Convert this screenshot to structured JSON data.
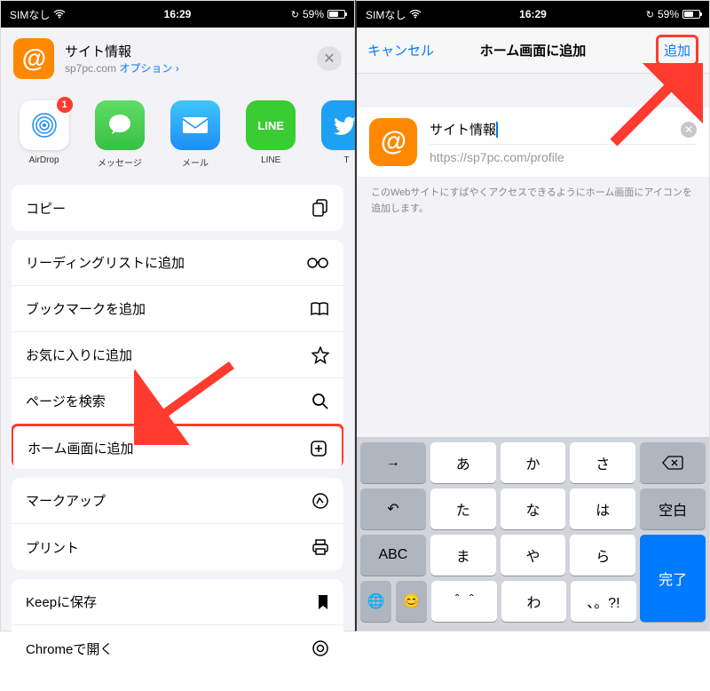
{
  "status": {
    "sim": "SIMなし",
    "wifi_icon": "wifi",
    "time": "16:29",
    "battery": "59%"
  },
  "left": {
    "header": {
      "title": "サイト情報",
      "domain": "sp7pc.com",
      "options": "オプション ›"
    },
    "apps": [
      {
        "name": "AirDrop",
        "badge": "1"
      },
      {
        "name": "メッセージ"
      },
      {
        "name": "メール"
      },
      {
        "name": "LINE"
      },
      {
        "name": "T"
      }
    ],
    "actions1": [
      "コピー"
    ],
    "actions2": [
      "リーディングリストに追加",
      "ブックマークを追加",
      "お気に入りに追加",
      "ページを検索",
      "ホーム画面に追加"
    ],
    "actions3": [
      "マークアップ",
      "プリント"
    ],
    "actions4": [
      "Keepに保存",
      "Chromeで開く"
    ]
  },
  "right": {
    "nav": {
      "cancel": "キャンセル",
      "title": "ホーム画面に追加",
      "add": "追加"
    },
    "form": {
      "title": "サイト情報",
      "url": "https://sp7pc.com/profile"
    },
    "help": "このWebサイトにすばやくアクセスできるようにホーム画面にアイコンを追加します。",
    "keys": {
      "r1": [
        "→",
        "あ",
        "か",
        "さ",
        "⌫"
      ],
      "r2": [
        "↶",
        "た",
        "な",
        "は",
        "空白"
      ],
      "r3": [
        "ABC",
        "ま",
        "や",
        "ら",
        "完了"
      ],
      "r4": [
        "🌐",
        "😊",
        "＾＾",
        "わ",
        "、。?!",
        ""
      ]
    }
  }
}
